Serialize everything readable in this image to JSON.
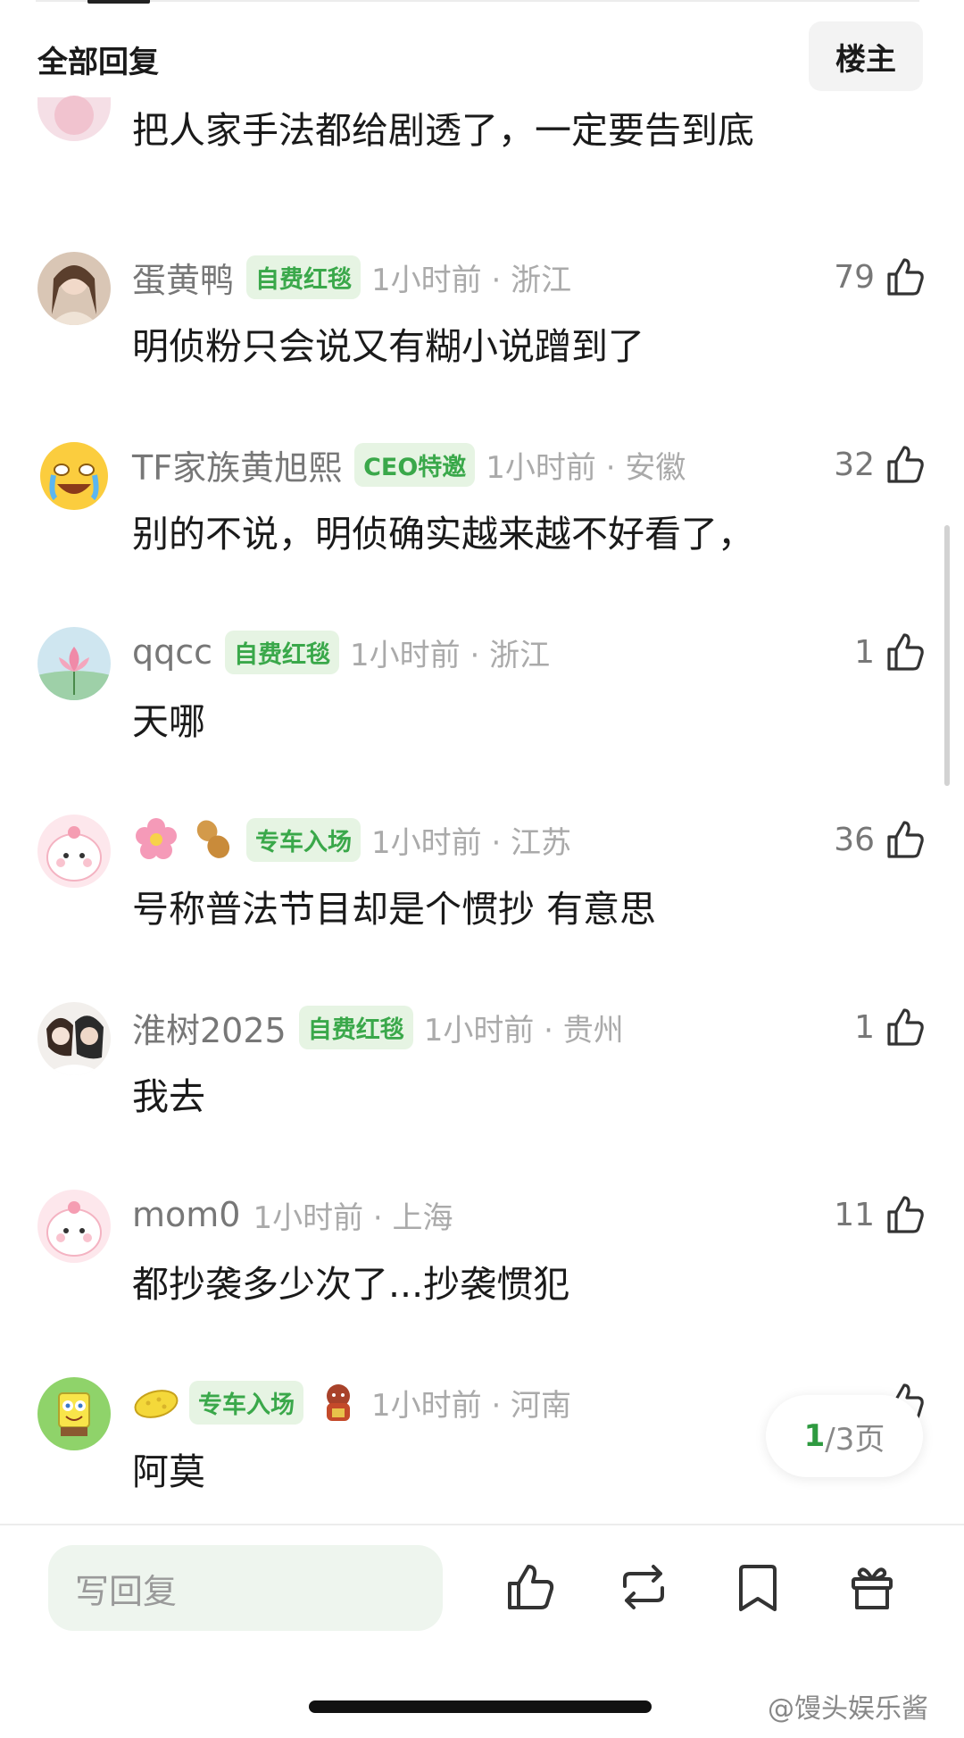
{
  "header": {
    "title": "全部回复",
    "op_button": "楼主"
  },
  "first_comment": {
    "text": "把人家手法都给剧透了，一定要告到底"
  },
  "comments": [
    {
      "username": "蛋黄鸭",
      "badge": "自费红毯",
      "time": "1小时前 · 浙江",
      "likes": "79",
      "text": "明侦粉只会说又有糊小说蹭到了"
    },
    {
      "username": "TF家族黄旭熙",
      "badge": "CEO特邀",
      "time": "1小时前 · 安徽",
      "likes": "32",
      "text": "别的不说，明侦确实越来越不好看了，"
    },
    {
      "username": "qqcc",
      "badge": "自费红毯",
      "time": "1小时前 · 浙江",
      "likes": "1",
      "text": "天哪"
    },
    {
      "username": "",
      "badge": "专车入场",
      "time": "1小时前 · 江苏",
      "likes": "36",
      "text": "号称普法节目却是个惯抄 有意思",
      "name_emojis": [
        "flower-emoji",
        "peanut-emoji"
      ]
    },
    {
      "username": "淮树2025",
      "badge": "自费红毯",
      "time": "1小时前 · 贵州",
      "likes": "1",
      "text": "我去"
    },
    {
      "username": "mom0",
      "badge": "",
      "time": "1小时前 · 上海",
      "likes": "11",
      "text": "都抄袭多少次了...抄袭惯犯"
    },
    {
      "username": "",
      "badge": "专车入场",
      "time": "1小时前 · 河南",
      "likes": "",
      "text": "阿莫",
      "name_emojis": [
        "sponge-emoji"
      ],
      "after_badge_emoji": "fortune-cat-emoji"
    }
  ],
  "pagination": {
    "current": "1",
    "total": "/3页"
  },
  "bottom_bar": {
    "reply_placeholder": "写回复",
    "icons": [
      "like-icon",
      "repost-icon",
      "bookmark-icon",
      "gift-icon"
    ]
  },
  "watermark": "@馒头娱乐酱",
  "colors": {
    "accent_green": "#3aa84a",
    "badge_bg": "#e6f4e3",
    "meta_gray": "#aaaaaa"
  }
}
